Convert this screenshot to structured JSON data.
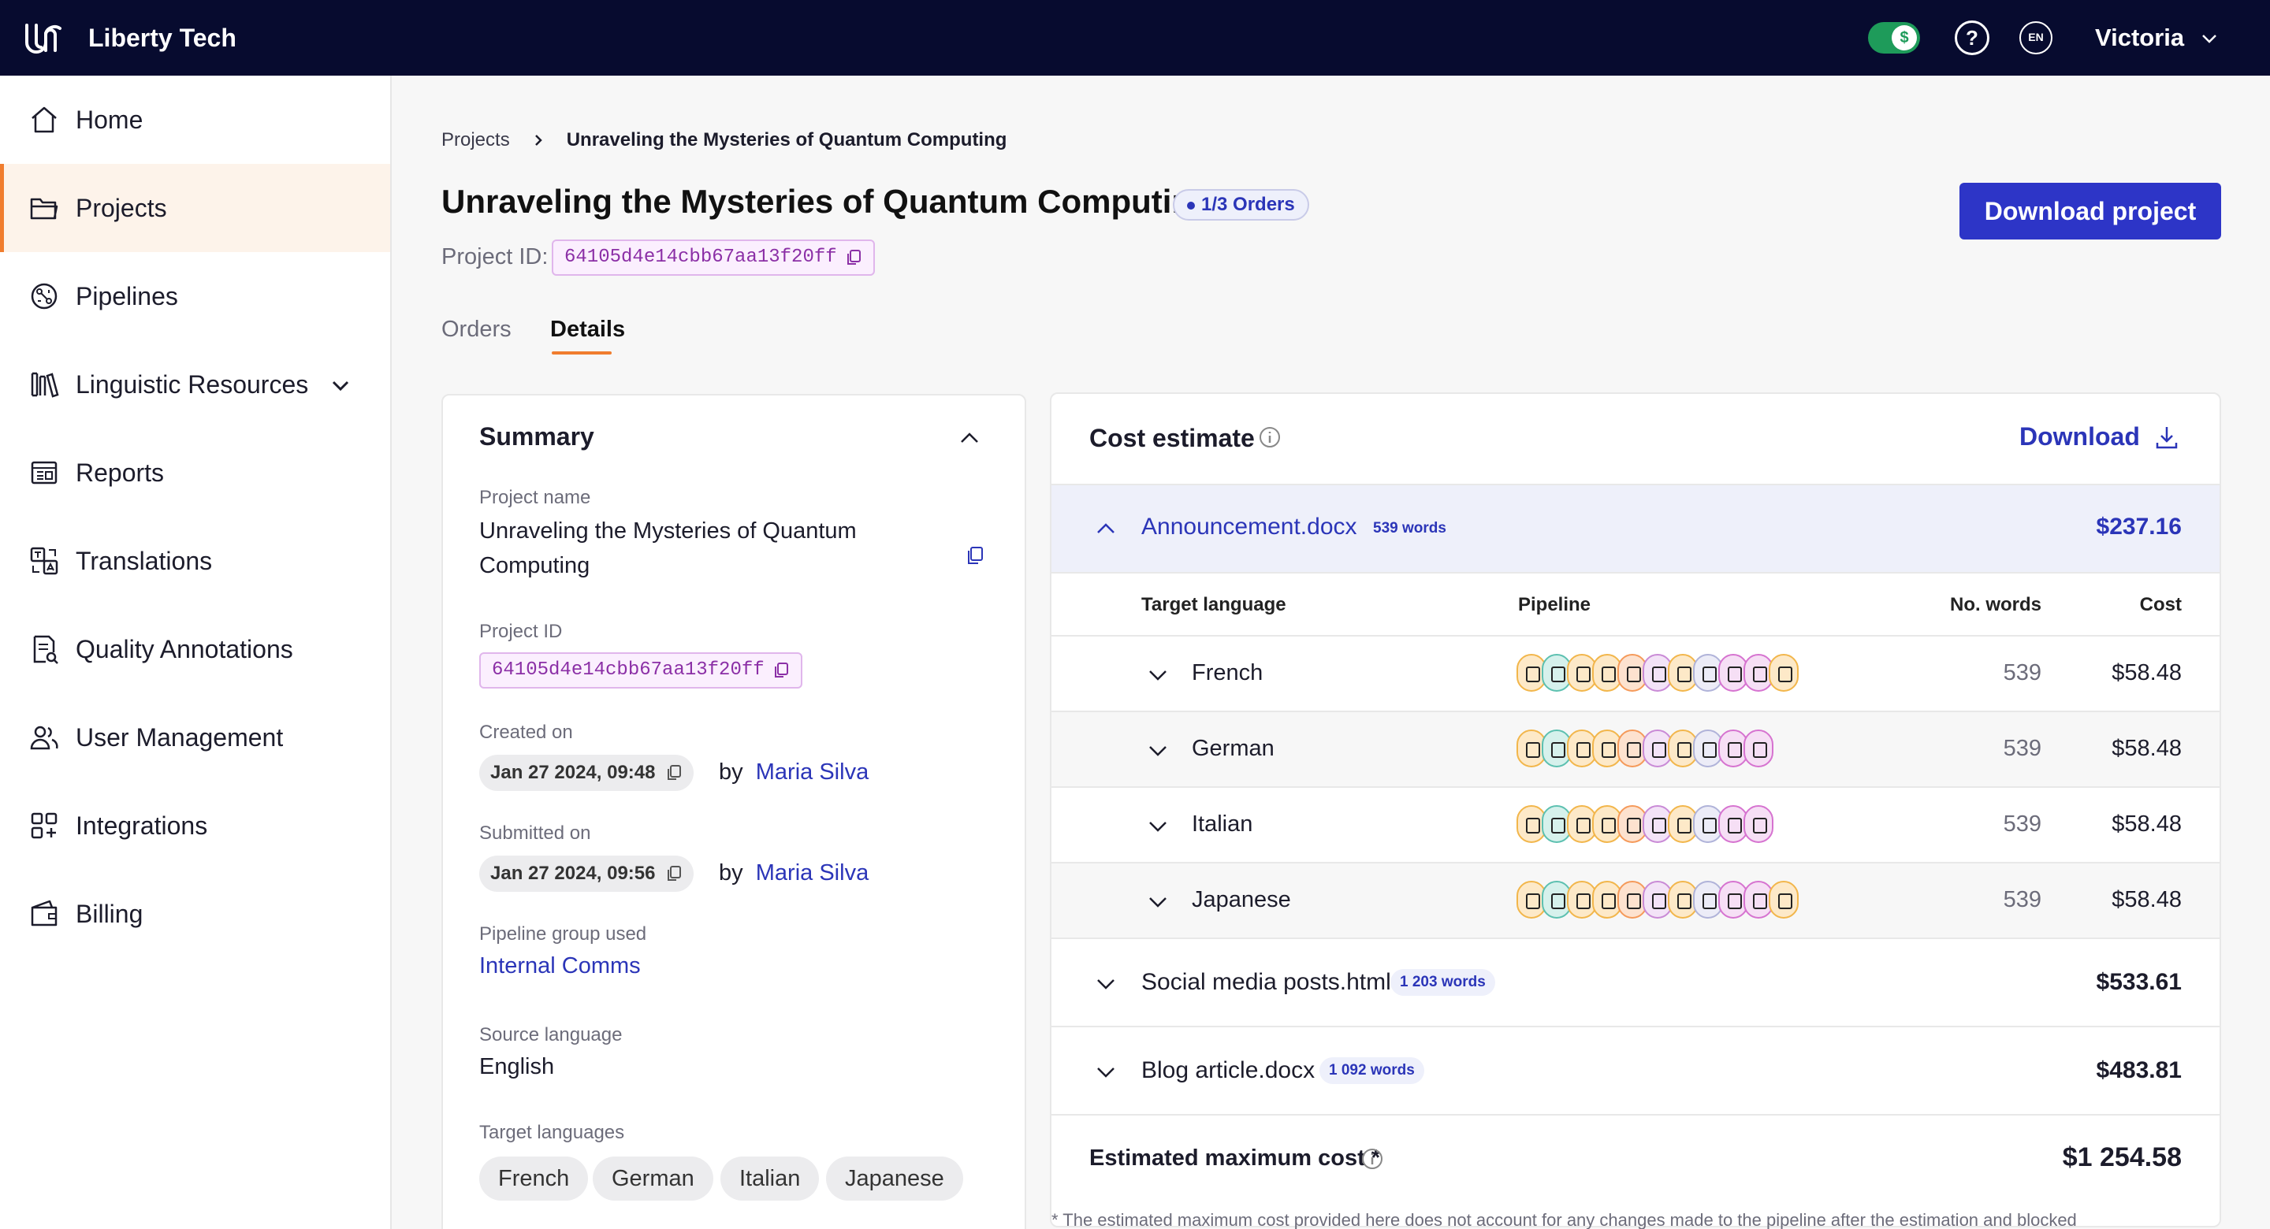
{
  "app": {
    "brand": "Liberty Tech",
    "user_name": "Victoria",
    "lang_code": "EN",
    "help_glyph": "?",
    "toggle_glyph": "$"
  },
  "sidebar": {
    "items": [
      {
        "label": "Home",
        "icon": "home-icon"
      },
      {
        "label": "Projects",
        "icon": "folder-icon",
        "active": true
      },
      {
        "label": "Pipelines",
        "icon": "pipeline-icon"
      },
      {
        "label": "Linguistic Resources",
        "icon": "library-icon",
        "expandable": true
      },
      {
        "label": "Reports",
        "icon": "report-icon"
      },
      {
        "label": "Translations",
        "icon": "translate-icon"
      },
      {
        "label": "Quality Annotations",
        "icon": "annotation-icon"
      },
      {
        "label": "User Management",
        "icon": "users-icon"
      },
      {
        "label": "Integrations",
        "icon": "integrations-icon"
      },
      {
        "label": "Billing",
        "icon": "wallet-icon"
      }
    ]
  },
  "breadcrumb": {
    "root": "Projects",
    "current": "Unraveling the Mysteries of Quantum Computing"
  },
  "header": {
    "title": "Unraveling the Mysteries of Quantum Computing",
    "orders_badge": "1/3 Orders",
    "project_id_label": "Project ID:",
    "project_id": "64105d4e14cbb67aa13f20ff",
    "download_label": "Download project"
  },
  "tabs": [
    {
      "label": "Orders"
    },
    {
      "label": "Details",
      "active": true
    }
  ],
  "summary": {
    "title": "Summary",
    "project_name_label": "Project name",
    "project_name_line1": "Unraveling the Mysteries of Quantum",
    "project_name_line2": "Computing",
    "project_id_label": "Project ID",
    "project_id": "64105d4e14cbb67aa13f20ff",
    "created_label": "Created on",
    "created_date": "Jan 27 2024, 09:48",
    "created_by_prefix": "by",
    "created_by": "Maria Silva",
    "submitted_label": "Submitted on",
    "submitted_date": "Jan 27 2024, 09:56",
    "submitted_by_prefix": "by",
    "submitted_by": "Maria Silva",
    "pipeline_group_label": "Pipeline group used",
    "pipeline_group": "Internal Comms",
    "source_language_label": "Source language",
    "source_language": "English",
    "target_languages_label": "Target languages",
    "target_languages": [
      "French",
      "German",
      "Italian",
      "Japanese"
    ]
  },
  "cost_estimate": {
    "title": "Cost estimate",
    "download_label": "Download",
    "columns": {
      "target_language": "Target language",
      "pipeline": "Pipeline",
      "words": "No. words",
      "cost": "Cost"
    },
    "files": [
      {
        "name": "Announcement.docx",
        "words": "539 words",
        "cost": "$237.16",
        "expanded": true,
        "languages": [
          {
            "name": "French",
            "words": "539",
            "cost": "$58.48",
            "pipeline_steps": 11
          },
          {
            "name": "German",
            "words": "539",
            "cost": "$58.48",
            "pipeline_steps": 10
          },
          {
            "name": "Italian",
            "words": "539",
            "cost": "$58.48",
            "pipeline_steps": 10
          },
          {
            "name": "Japanese",
            "words": "539",
            "cost": "$58.48",
            "pipeline_steps": 11
          }
        ]
      },
      {
        "name": "Social media posts.html",
        "words": "1 203 words",
        "cost": "$533.61"
      },
      {
        "name": "Blog article.docx",
        "words": "1 092 words",
        "cost": "$483.81"
      }
    ],
    "total_label": "Estimated maximum cost *",
    "total_value": "$1 254.58",
    "footnote": "* The estimated maximum cost provided here does not account for any changes made to the pipeline after the estimation and blocked"
  },
  "colors": {
    "accent": "#2d35c7",
    "active_nav": "#f07d2e",
    "topbar": "#070b2f",
    "toggle": "#1e9b5a"
  }
}
